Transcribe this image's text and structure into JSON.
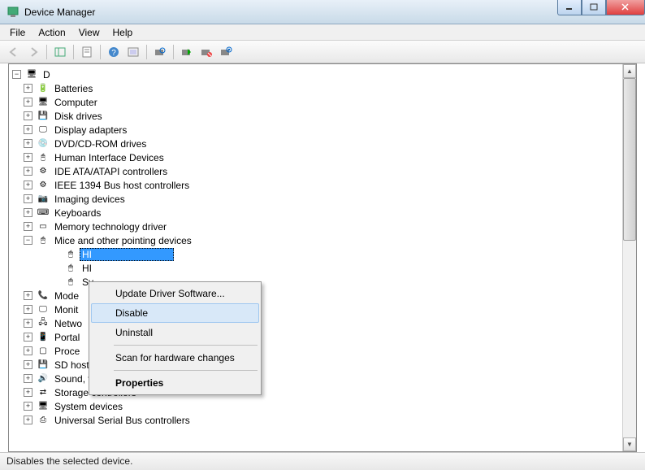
{
  "window": {
    "title": "Device Manager"
  },
  "menu": {
    "file": "File",
    "action": "Action",
    "view": "View",
    "help": "Help"
  },
  "tree": {
    "root": "D",
    "categories": [
      {
        "label": "Batteries",
        "icon": "battery"
      },
      {
        "label": "Computer",
        "icon": "computer"
      },
      {
        "label": "Disk drives",
        "icon": "disk"
      },
      {
        "label": "Display adapters",
        "icon": "display"
      },
      {
        "label": "DVD/CD-ROM drives",
        "icon": "cd"
      },
      {
        "label": "Human Interface Devices",
        "icon": "hid"
      },
      {
        "label": "IDE ATA/ATAPI controllers",
        "icon": "controller"
      },
      {
        "label": "IEEE 1394 Bus host controllers",
        "icon": "controller"
      },
      {
        "label": "Imaging devices",
        "icon": "imaging"
      },
      {
        "label": "Keyboards",
        "icon": "keyboard"
      },
      {
        "label": "Memory technology driver",
        "icon": "memory"
      },
      {
        "label": "Mice and other pointing devices",
        "icon": "mouse",
        "expanded": true,
        "children": [
          {
            "label": "HI",
            "selected": true
          },
          {
            "label": "HI"
          },
          {
            "label": "Sy"
          }
        ]
      },
      {
        "label": "Mode",
        "icon": "modem"
      },
      {
        "label": "Monit",
        "icon": "monitor"
      },
      {
        "label": "Netwo",
        "icon": "network"
      },
      {
        "label": "Portal",
        "icon": "portable"
      },
      {
        "label": "Proce",
        "icon": "processor"
      },
      {
        "label": "SD host adapters",
        "icon": "sd"
      },
      {
        "label": "Sound, video and game controllers",
        "icon": "sound"
      },
      {
        "label": "Storage controllers",
        "icon": "storage"
      },
      {
        "label": "System devices",
        "icon": "system"
      },
      {
        "label": "Universal Serial Bus controllers",
        "icon": "usb"
      }
    ]
  },
  "context_menu": {
    "update": "Update Driver Software...",
    "disable": "Disable",
    "uninstall": "Uninstall",
    "scan": "Scan for hardware changes",
    "properties": "Properties"
  },
  "status": "Disables the selected device."
}
